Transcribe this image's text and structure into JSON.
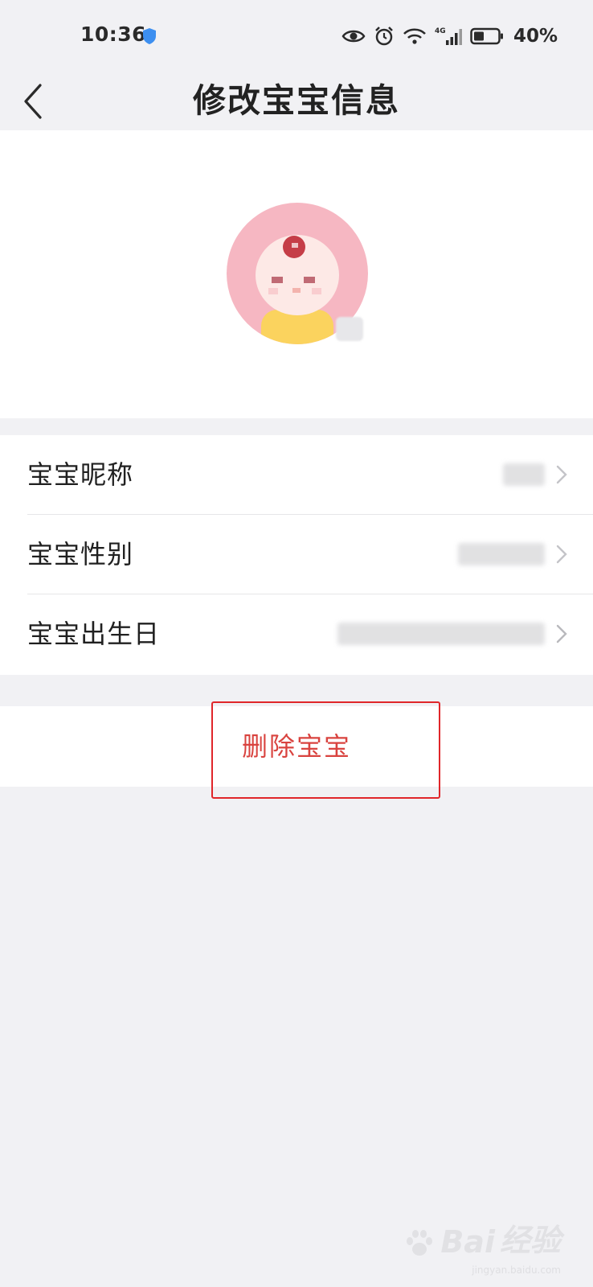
{
  "status_bar": {
    "time": "10:36",
    "battery": "40%",
    "icons": [
      "shield-icon",
      "eye-icon",
      "alarm-icon",
      "wifi-icon",
      "signal-4g-icon",
      "battery-icon"
    ]
  },
  "header": {
    "title": "修改宝宝信息",
    "back_icon": "chevron-left-icon"
  },
  "avatar": {
    "description_icon": "baby-avatar-icon"
  },
  "info_rows": [
    {
      "label": "宝宝昵称"
    },
    {
      "label": "宝宝性别"
    },
    {
      "label": "宝宝出生日"
    }
  ],
  "delete": {
    "label": "删除宝宝",
    "color": "#d9433f"
  },
  "watermark": {
    "brand": "Bai",
    "suffix": "经验",
    "url": "jingyan.baidu.com"
  },
  "colors": {
    "background": "#f1f1f4",
    "card": "#ffffff",
    "highlight": "#e0262a",
    "avatar_pink": "#f6b7c2"
  }
}
